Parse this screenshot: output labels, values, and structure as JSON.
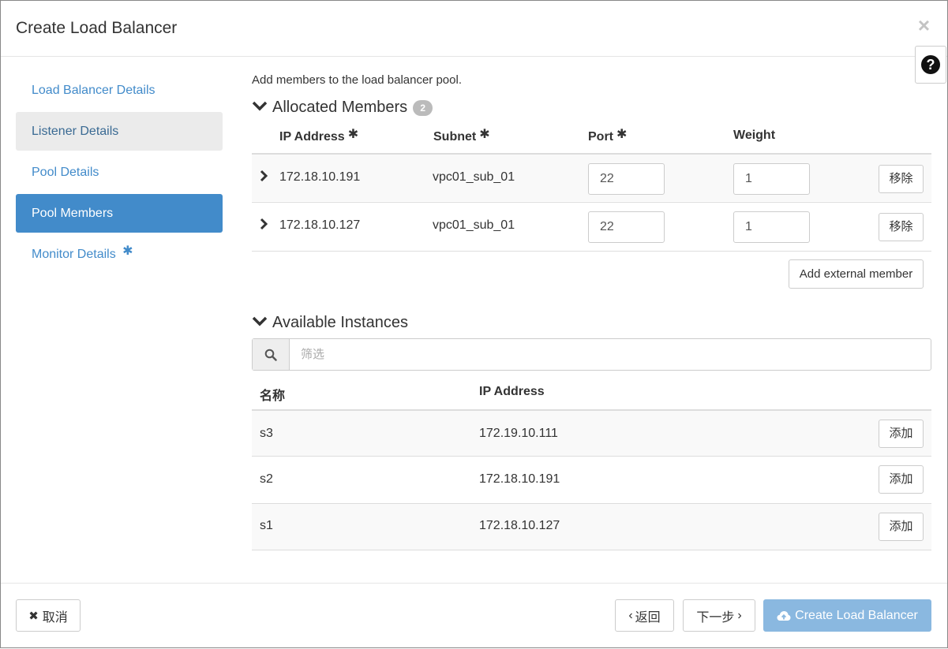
{
  "modal": {
    "title": "Create Load Balancer",
    "close_icon": "×",
    "help_icon": "?"
  },
  "sidebar": {
    "items": [
      {
        "label": "Load Balancer Details",
        "state": "normal"
      },
      {
        "label": "Listener Details",
        "state": "visited"
      },
      {
        "label": "Pool Details",
        "state": "normal"
      },
      {
        "label": "Pool Members",
        "state": "active"
      },
      {
        "label": "Monitor Details",
        "state": "normal",
        "required_mark": "✱"
      }
    ]
  },
  "main": {
    "intro": "Add members to the load balancer pool.",
    "allocated": {
      "title": "Allocated Members",
      "count": "2",
      "columns": {
        "ip": "IP Address",
        "subnet": "Subnet",
        "port": "Port",
        "weight": "Weight",
        "required_mark": "✱"
      },
      "rows": [
        {
          "ip": "172.18.10.191",
          "subnet": "vpc01_sub_01",
          "port": "22",
          "weight": "1",
          "remove_label": "移除"
        },
        {
          "ip": "172.18.10.127",
          "subnet": "vpc01_sub_01",
          "port": "22",
          "weight": "1",
          "remove_label": "移除"
        }
      ],
      "add_external_label": "Add external member"
    },
    "available": {
      "title": "Available Instances",
      "filter_placeholder": "筛选",
      "columns": {
        "name": "名称",
        "ip": "IP Address"
      },
      "rows": [
        {
          "name": "s3",
          "ip": "172.19.10.111",
          "add_label": "添加"
        },
        {
          "name": "s2",
          "ip": "172.18.10.191",
          "add_label": "添加"
        },
        {
          "name": "s1",
          "ip": "172.18.10.127",
          "add_label": "添加"
        }
      ]
    }
  },
  "footer": {
    "cancel_label": "取消",
    "back_label": "返回",
    "next_label": "下一步",
    "create_label": "Create Load Balancer"
  },
  "colors": {
    "accent": "#428bca",
    "primary_disabled": "#8ab8e0",
    "visited_bg": "#ebebeb"
  }
}
